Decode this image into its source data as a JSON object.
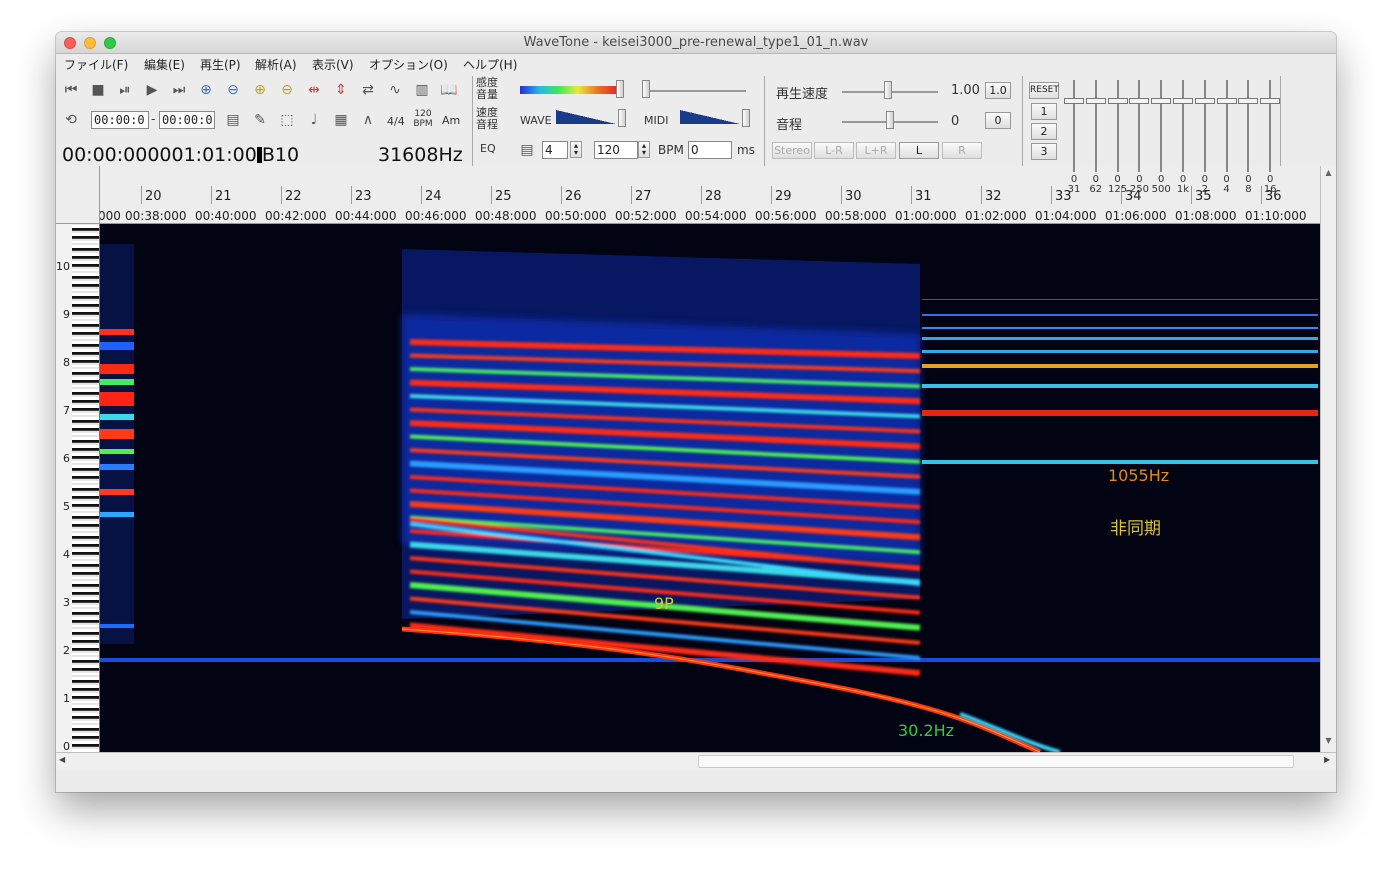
{
  "window": {
    "title": "WaveTone - keisei3000_pre-renewal_type1_01_n.wav"
  },
  "menu": [
    {
      "label": "ファイル(F)"
    },
    {
      "label": "編集(E)"
    },
    {
      "label": "再生(P)"
    },
    {
      "label": "解析(A)"
    },
    {
      "label": "表示(V)"
    },
    {
      "label": "オプション(O)"
    },
    {
      "label": "ヘルプ(H)"
    }
  ],
  "toolbar": {
    "range_start": "00:00:0",
    "range_sep": "-",
    "range_end": "00:00:0",
    "time_sig": "4/4",
    "bpm_small_top": "120",
    "bpm_small_bottom": "BPM",
    "key_label": "Am",
    "position_display": "00:00:000001:01:00",
    "position_note": "B10",
    "frequency_display": "31608Hz",
    "eq_label": "EQ",
    "kando_label": "感度",
    "onryo_label": "音量",
    "sokudo_label": "速度",
    "ontei_label": "音程",
    "wave_label": "WAVE",
    "midi_label": "MIDI",
    "beats_value": "4",
    "bpm_value": "120",
    "bpm_label": "BPM",
    "ms_value": "0",
    "ms_label": "ms",
    "playback_speed_label": "再生速度",
    "playback_speed_value": "1.00",
    "playback_speed_reset": "1.0",
    "pitch_label": "音程",
    "pitch_value": "0",
    "pitch_reset": "0",
    "stereo_buttons": [
      "Stereo",
      "L-R",
      "L+R",
      "L",
      "R"
    ],
    "eq_reset": "RESET",
    "eq_presets": [
      "1",
      "2",
      "3"
    ]
  },
  "equalizer": {
    "bands": [
      "31",
      "62",
      "125",
      "250",
      "500",
      "1k",
      "2",
      "4",
      "8",
      "16"
    ],
    "values": [
      "0",
      "0",
      "0",
      "0",
      "0",
      "0",
      "0",
      "0",
      "0",
      "0"
    ]
  },
  "ruler": {
    "bars": [
      "20",
      "21",
      "22",
      "23",
      "24",
      "25",
      "26",
      "27",
      "28",
      "29",
      "30",
      "31",
      "32",
      "33",
      "34",
      "35",
      "36"
    ],
    "times": [
      "000",
      "00:38:000",
      "00:40:000",
      "00:42:000",
      "00:44:000",
      "00:46:000",
      "00:48:000",
      "00:50:000",
      "00:52:000",
      "00:54:000",
      "00:56:000",
      "00:58:000",
      "01:00:000",
      "01:02:000",
      "01:04:000",
      "01:06:000",
      "01:08:000",
      "01:10:000"
    ]
  },
  "keyboard": {
    "octaves": [
      "10",
      "9",
      "8",
      "7",
      "6",
      "5",
      "4",
      "3",
      "2",
      "1",
      "0"
    ]
  },
  "annotations": {
    "freq_1055": "1055Hz",
    "non_sync": "非同期",
    "nine_p": "9P",
    "freq_302": "30.2Hz"
  },
  "colors": {
    "annotation_orange": "#e08a1a",
    "annotation_yellow": "#d8c53a",
    "annotation_green": "#2ecf3a",
    "spectrogram_bg": "#020313"
  }
}
